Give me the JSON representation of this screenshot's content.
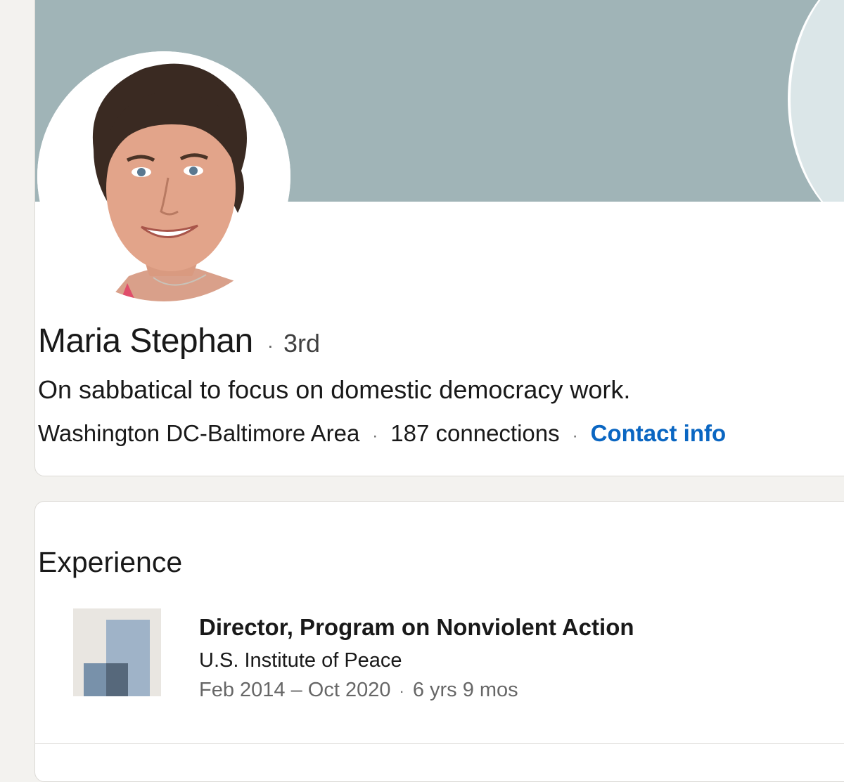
{
  "profile": {
    "name": "Maria Stephan",
    "separator": "·",
    "degree": "3rd",
    "headline": "On sabbatical to focus on domestic democracy work.",
    "location": "Washington DC-Baltimore Area",
    "connections": "187 connections",
    "contact_info": "Contact info",
    "avatar_icon": "profile-photo"
  },
  "experience": {
    "title": "Experience",
    "items": [
      {
        "job_title": "Director, Program on Nonviolent Action",
        "company": "U.S. Institute of Peace",
        "dates": "Feb 2014 – Oct 2020",
        "duration": "6 yrs 9 mos",
        "logo_icon": "company-logo"
      }
    ]
  },
  "colors": {
    "banner": "#a0b4b7",
    "link": "#0a66c2",
    "page_background": "#f3f2ef"
  }
}
